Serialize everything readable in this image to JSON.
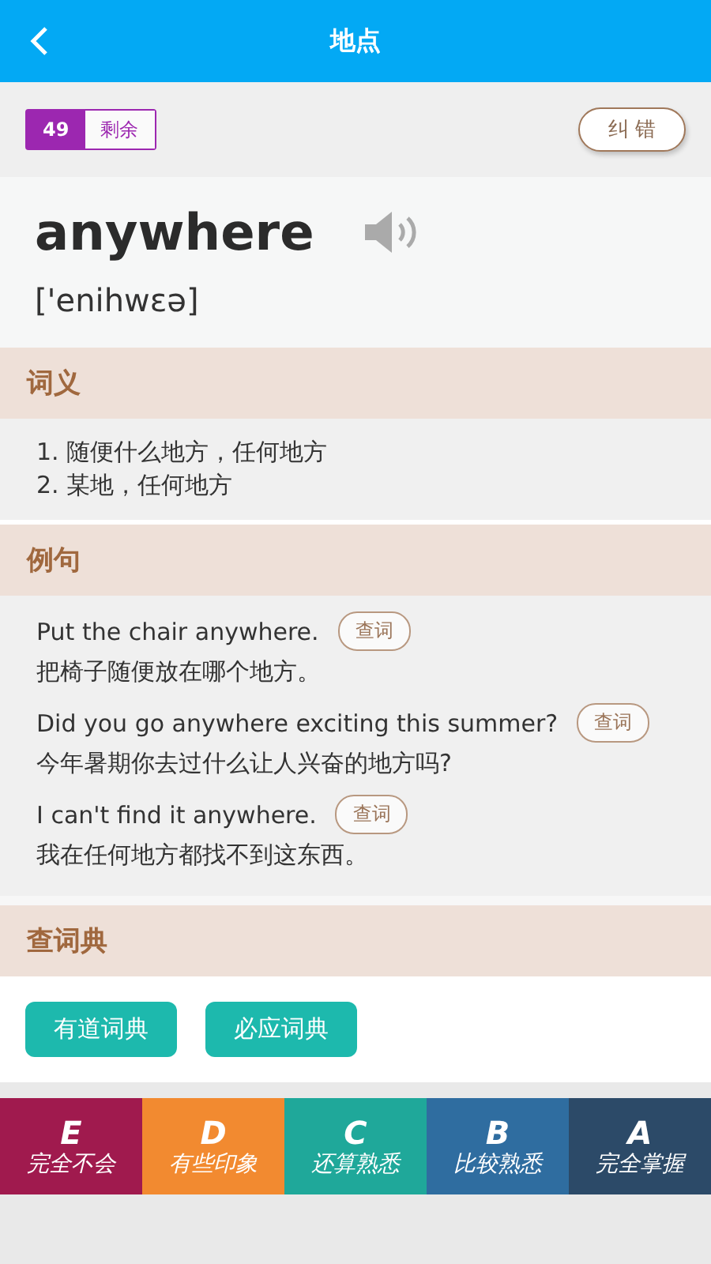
{
  "header": {
    "title": "地点"
  },
  "progress": {
    "count": "49",
    "label": "剩余"
  },
  "report_button": "纠 错",
  "word": {
    "text": "anywhere",
    "phonetic": "['enihwɛə]"
  },
  "meanings": {
    "title": "词义",
    "items": [
      "1. 随便什么地方，任何地方",
      "2. 某地，任何地方"
    ]
  },
  "examples": {
    "title": "例句",
    "items": [
      {
        "en": "Put the chair anywhere.",
        "zh": "把椅子随便放在哪个地方。",
        "lookup": "查词"
      },
      {
        "en": "Did you go anywhere exciting this summer?",
        "zh": "今年暑期你去过什么让人兴奋的地方吗?",
        "lookup": "查词"
      },
      {
        "en": "I can't find it anywhere.",
        "zh": "我在任何地方都找不到这东西。",
        "lookup": "查词"
      }
    ]
  },
  "dictionaries": {
    "title": "查词典",
    "buttons": [
      "有道词典",
      "必应词典"
    ]
  },
  "grades": [
    {
      "letter": "E",
      "label": "完全不会",
      "color": "#a01a4e"
    },
    {
      "letter": "D",
      "label": "有些印象",
      "color": "#f28a30"
    },
    {
      "letter": "C",
      "label": "还算熟悉",
      "color": "#1fa89a"
    },
    {
      "letter": "B",
      "label": "比较熟悉",
      "color": "#2f6da0"
    },
    {
      "letter": "A",
      "label": "完全掌握",
      "color": "#2c4a68"
    }
  ]
}
